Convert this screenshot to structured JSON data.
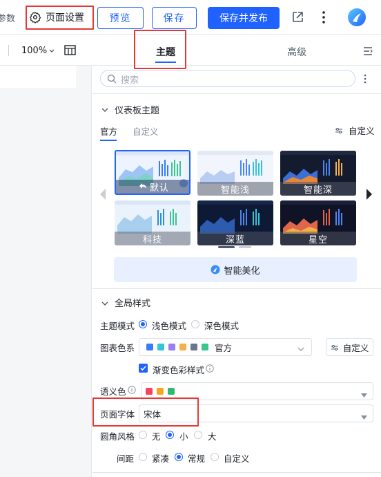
{
  "topbar": {
    "params_cut": "参数",
    "page_settings": "页面设置",
    "preview": "预览",
    "save": "保存",
    "save_publish": "保存并发布"
  },
  "left": {
    "zoom": "100%"
  },
  "panel": {
    "tabs": [
      "主题",
      "高级"
    ],
    "search_placeholder": "搜索",
    "dashboard_section": "仪表板主题",
    "subtabs": [
      "官方",
      "自定义"
    ],
    "customize": "自定义",
    "themes": [
      "默认",
      "智能浅",
      "智能深",
      "科技",
      "深蓝",
      "星空"
    ],
    "beautify": "智能美化",
    "global_section": "全局样式",
    "theme_mode_label": "主题模式",
    "theme_modes": [
      "浅色模式",
      "深色模式"
    ],
    "chart_color_label": "图表色系",
    "chart_color_value": "官方",
    "chart_color_custom": "自定义",
    "gradient_label": "渐变色彩样式",
    "semantic_label": "语义色",
    "font_label": "页面字体",
    "font_value": "宋体",
    "radius_label": "圆角风格",
    "radius_options": [
      "无",
      "小",
      "大"
    ],
    "spacing_label": "间距",
    "spacing_options": [
      "紧凑",
      "常规",
      "自定义"
    ]
  },
  "colors": {
    "accent": "#1f62ff",
    "chart_palette": [
      "#3b7bf6",
      "#36c4d9",
      "#9b7ff0",
      "#f5b04a",
      "#6c7590",
      "#3cc58e"
    ],
    "semantic": [
      "#f5455c",
      "#f5a623",
      "#2cb970"
    ],
    "highlight_box": "#e53935"
  }
}
